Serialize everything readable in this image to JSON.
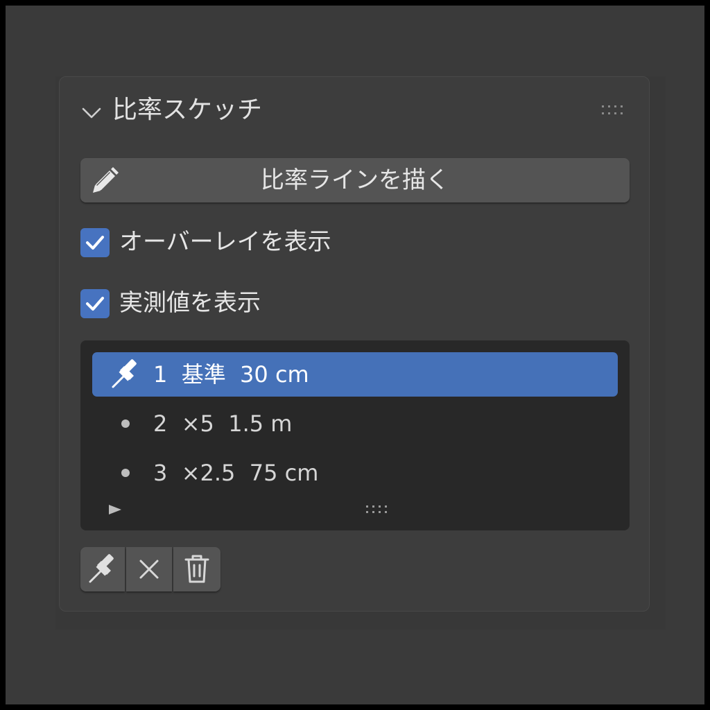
{
  "panel": {
    "title": "比率スケッチ"
  },
  "draw_button": {
    "label": "比率ラインを描く"
  },
  "options": {
    "show_overlay": {
      "label": "オーバーレイを表示",
      "checked": true
    },
    "show_measurements": {
      "label": "実測値を表示",
      "checked": true
    }
  },
  "lines": [
    {
      "text": "1  基準  30 cm",
      "active": true,
      "icon": "pin-icon"
    },
    {
      "text": "2  ×5  1.5 m",
      "active": false,
      "icon": "bullet-icon"
    },
    {
      "text": "3  ×2.5  75 cm",
      "active": false,
      "icon": "bullet-icon"
    }
  ],
  "toolbar": {
    "icons": [
      "pin-icon",
      "close-icon",
      "trash-icon"
    ]
  },
  "colors": {
    "accent": "#4571b8",
    "checkbox": "#4773c0",
    "panel": "#3d3d3d",
    "button": "#545454",
    "list_bg": "#282828"
  }
}
